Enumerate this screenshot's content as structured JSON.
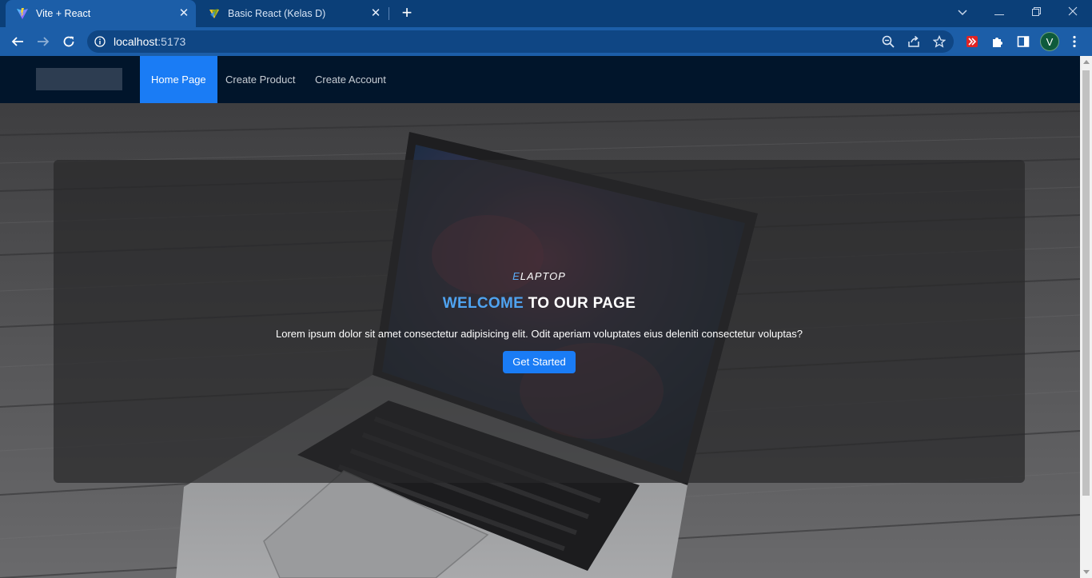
{
  "browser": {
    "tabs": [
      {
        "title": "Vite + React",
        "active": true,
        "favicon": "vite-icon"
      },
      {
        "title": "Basic React (Kelas D)",
        "active": false,
        "favicon": "vitest-icon"
      }
    ],
    "address": {
      "host": "localhost",
      "port": ":5173"
    },
    "profile_initial": "V"
  },
  "site": {
    "nav": {
      "links": [
        {
          "label": "Home Page",
          "active": true
        },
        {
          "label": "Create Product",
          "active": false
        },
        {
          "label": "Create Account",
          "active": false
        }
      ]
    },
    "hero": {
      "brand_first": "E",
      "brand_rest": "LAPTOP",
      "headline_highlight": "WELCOME",
      "headline_rest": " TO OUR PAGE",
      "lead": "Lorem ipsum dolor sit amet consectetur adipisicing elit. Odit aperiam voluptates eius deleniti consectetur voluptas?",
      "cta_label": "Get Started"
    }
  },
  "colors": {
    "tabstrip": "#0b3f78",
    "toolbar": "#1c5ea8",
    "site_nav": "#01152b",
    "accent": "#1a7cf5",
    "headline_highlight": "#4fa3f0"
  }
}
